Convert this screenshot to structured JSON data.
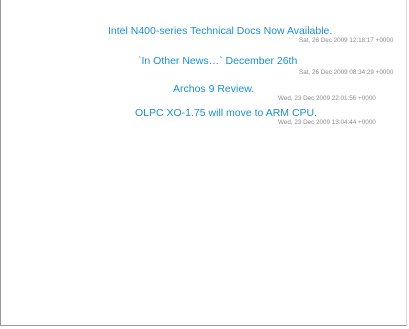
{
  "feed": {
    "items": [
      {
        "title": "Intel N400-series Technical Docs Now Available.",
        "date": "Sat, 26 Dec 2009 12:18:17 +0000"
      },
      {
        "title": "`In Other News…` December 26th",
        "date": "Sat, 26 Dec 2009 08:34:29 +0000"
      },
      {
        "title": "Archos 9 Review.",
        "date": "Wed, 23 Dec 2009 22:01:56 +0000"
      },
      {
        "title": "OLPC XO-1.75 will move to ARM CPU.",
        "date": "Wed, 23 Dec 2009 13:04:44 +0000"
      }
    ]
  },
  "colors": {
    "link": "#1a8fd0",
    "date": "#8c8c8c",
    "border": "#9a9a9a"
  }
}
